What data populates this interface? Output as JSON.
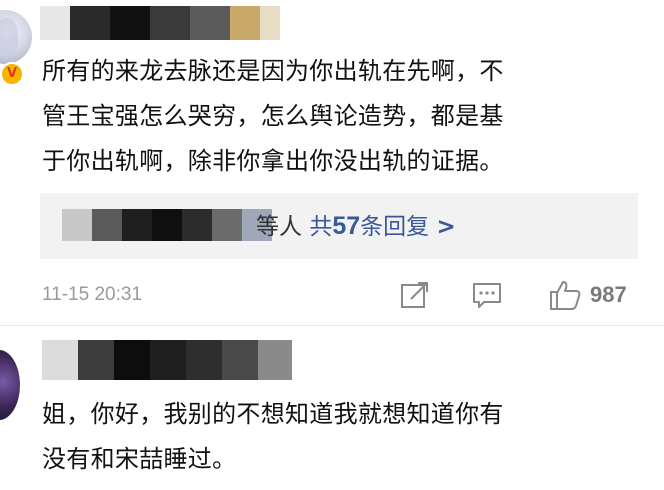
{
  "comments": [
    {
      "badge": "V",
      "text_line1": "所有的来龙去脉还是因为你出轨在先啊，不",
      "text_line2": "管王宝强怎么哭穷，怎么舆论造势，都是基",
      "text_line3": "于你出轨啊，除非你拿出你没出轨的证据。",
      "reply_suffix": "等人",
      "reply_prefix": "共",
      "reply_count": "57",
      "reply_unit": "条回复",
      "reply_chevron": ">",
      "timestamp": "11-15 20:31",
      "like_count": "987",
      "icons": [
        "share-icon",
        "comment-icon",
        "like-icon"
      ]
    },
    {
      "text_line1": "姐，你好，我别的不想知道我就想知道你有",
      "text_line2": "没有和宋喆睡过。"
    }
  ],
  "colors": {
    "link": "#3b5998",
    "muted": "#9a9a9a",
    "reply_bg": "#f2f2f2",
    "badge": "#f7b500"
  }
}
